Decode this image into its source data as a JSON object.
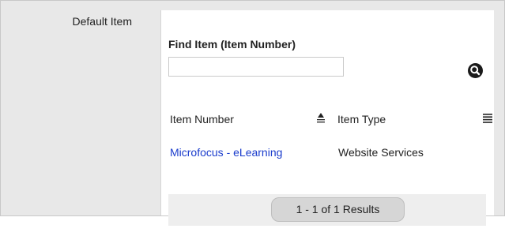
{
  "field": {
    "label": "Default Item"
  },
  "finder": {
    "title": "Find Item (Item Number)",
    "input_value": "",
    "input_placeholder": "",
    "search_icon": "magnifier-icon"
  },
  "table": {
    "columns": [
      {
        "label": "Item Number",
        "icon": "sort-ascending-icon"
      },
      {
        "label": "Item Type",
        "icon": "column-menu-icon"
      }
    ],
    "rows": [
      {
        "item_number": "Microfocus - eLearning",
        "item_type": "Website Services"
      }
    ]
  },
  "pagination": {
    "results_text": "1 - 1 of 1 Results"
  },
  "colors": {
    "link": "#1a3ccc",
    "panel_bg": "#e8e8e8"
  }
}
